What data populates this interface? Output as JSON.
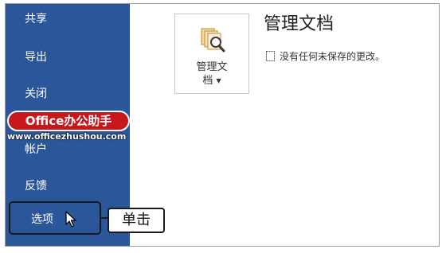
{
  "sidebar": {
    "items": [
      {
        "label": "共享"
      },
      {
        "label": "导出"
      },
      {
        "label": "关闭"
      },
      {
        "label": "帐户"
      },
      {
        "label": "反馈"
      },
      {
        "label": "选项"
      }
    ]
  },
  "watermark": {
    "brand": "Office办公助手",
    "url": "www.officezhushou.com"
  },
  "manage": {
    "tile_label_line1": "管理文",
    "tile_label_line2": "档",
    "title": "管理文档",
    "note": "没有任何未保存的更改。"
  },
  "callout": {
    "text": "单击"
  },
  "colors": {
    "sidebar_bg": "#2b579a",
    "brand_red": "#c8161d"
  }
}
